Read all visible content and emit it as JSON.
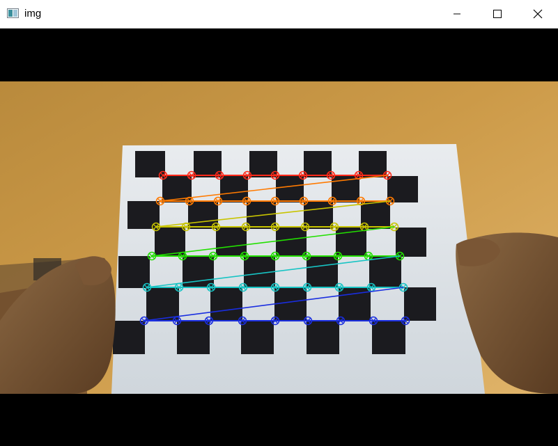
{
  "window": {
    "title": "img",
    "controls": {
      "minimize": "minimize-icon",
      "maximize": "maximize-icon",
      "close": "close-icon"
    }
  },
  "overlay": {
    "description_colors": [
      "#ff2a1a",
      "#ff7a00",
      "#c8c400",
      "#22e000",
      "#17c4c4",
      "#1a2ee0"
    ]
  }
}
